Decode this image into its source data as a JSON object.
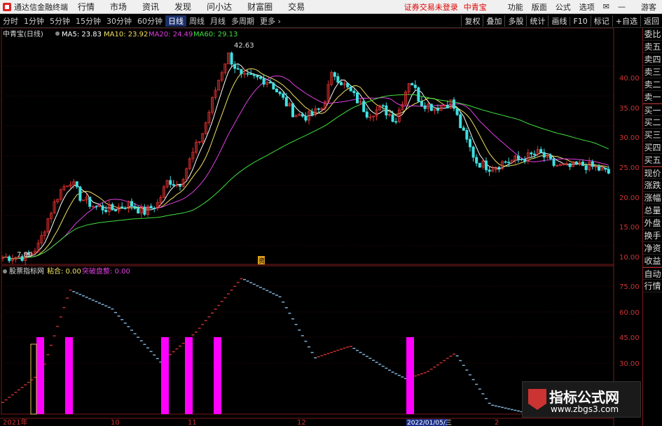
{
  "menubar": {
    "app_title": "通达信金融终端",
    "items": [
      "行情",
      "市场",
      "资讯",
      "发现",
      "问小达",
      "财富圈",
      "交易"
    ],
    "warning": "证券交易未登录",
    "stock_name": "中青宝",
    "right_items": [
      "功能",
      "版面",
      "公式",
      "选项"
    ],
    "guest": "游客"
  },
  "periodbar": {
    "periods": [
      "分时",
      "1分钟",
      "5分钟",
      "15分钟",
      "30分钟",
      "60分钟",
      "日线",
      "周线",
      "月线",
      "多周期",
      "更多"
    ],
    "active": "日线",
    "tools": [
      "复权",
      "叠加",
      "多股",
      "统计",
      "画线",
      "F10",
      "标记",
      "+自选",
      "返回"
    ]
  },
  "main_chart": {
    "title": "中青宝(日线)",
    "ma": [
      {
        "label": "MA5: 23.83",
        "color": "#ffffff"
      },
      {
        "label": "MA10: 23.92",
        "color": "#f0e060"
      },
      {
        "label": "MA20: 24.49",
        "color": "#e040e0"
      },
      {
        "label": "MA60: 29.13",
        "color": "#40e040"
      }
    ],
    "y_ticks": [
      "40.00",
      "35.00",
      "30.00",
      "25.00",
      "20.00",
      "15.00",
      "10.00"
    ],
    "high_label": "42.63",
    "low_label": "7.80",
    "event_marker": "资"
  },
  "indicator": {
    "title": "股票指标网",
    "line1": "粘合: 0.00",
    "line2": "突破盘整: 0.00",
    "y_ticks": [
      "75.00",
      "60.00",
      "45.00",
      "30.00"
    ]
  },
  "x_axis": {
    "labels": [
      "2021年",
      "10",
      "11",
      "12",
      "2022/01/05/三",
      "2"
    ]
  },
  "sidebar": {
    "items": [
      "委比",
      "卖五",
      "卖四",
      "卖三",
      "卖二",
      "卖一",
      "买一",
      "买二",
      "买三",
      "买四",
      "买五",
      "现价",
      "涨跌",
      "涨幅",
      "总量",
      "外盘",
      "换手",
      "净资",
      "收益"
    ],
    "items2": [
      "自动",
      "行情"
    ]
  },
  "watermark": {
    "title": "指标公式网",
    "url": "www.zbgs3.com"
  },
  "colors": {
    "up": "#e03030",
    "down": "#40e0e0",
    "ma5": "#ffffff",
    "ma10": "#f0e060",
    "ma20": "#e040e0",
    "ma60": "#40e040",
    "bar": "#ff00ff"
  }
}
